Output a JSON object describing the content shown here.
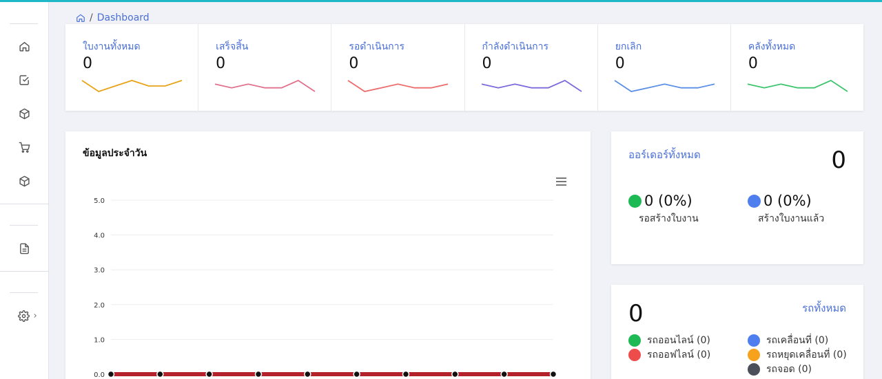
{
  "breadcrumb": {
    "home_icon": "home-icon",
    "separator": "/",
    "current": "Dashboard"
  },
  "sidebar": {
    "icons": [
      "home-icon",
      "checkbox-icon",
      "box-icon",
      "cart-icon",
      "box-icon",
      "document-icon",
      "gear-icon",
      "chevron-right-icon"
    ]
  },
  "stats": [
    {
      "label": "ใบงานทั้งหมด",
      "value": "0",
      "color": "#e8a317",
      "spark": [
        2,
        0,
        1,
        2,
        1,
        1,
        2
      ]
    },
    {
      "label": "เสร็จสิ้น",
      "value": "0",
      "color": "#e0718d",
      "spark": [
        2,
        1,
        2,
        1,
        1,
        3,
        0
      ]
    },
    {
      "label": "รอดำเนินการ",
      "value": "0",
      "color": "#ec6b6b",
      "spark": [
        3,
        0,
        1,
        2,
        1,
        1,
        2
      ]
    },
    {
      "label": "กำลังดำเนินการ",
      "value": "0",
      "color": "#7b68d9",
      "spark": [
        2,
        1,
        2,
        1,
        1,
        3,
        0
      ]
    },
    {
      "label": "ยกเลิก",
      "value": "0",
      "color": "#5b8ee6",
      "spark": [
        3,
        0,
        1,
        2,
        1,
        1,
        2
      ]
    },
    {
      "label": "คลังทั้งหมด",
      "value": "0",
      "color": "#3cc46d",
      "spark": [
        2,
        1,
        2,
        1,
        1,
        3,
        0
      ]
    }
  ],
  "daily": {
    "title": "ข้อมูลประจำวัน",
    "menu_icon": "hamburger-menu-icon"
  },
  "chart_data": {
    "type": "line",
    "title": "ข้อมูลประจำวัน",
    "xlabel": "",
    "ylabel": "",
    "ylim": [
      0,
      5
    ],
    "y_ticks": [
      "0.0",
      "1.0",
      "2.0",
      "3.0",
      "4.0",
      "5.0"
    ],
    "grid": true,
    "series": [
      {
        "values": [
          0,
          0,
          0,
          0,
          0,
          0,
          0,
          0,
          0,
          0
        ],
        "color": "#b3222a"
      }
    ]
  },
  "orders": {
    "title": "ออร์เดอร์ทั้งหมด",
    "total": "0",
    "items": [
      {
        "value": "0 (0%)",
        "label": "รอสร้างใบงาน",
        "color": "#1db954"
      },
      {
        "value": "0 (0%)",
        "label": "สร้างใบงานแล้ว",
        "color": "#4f7fef"
      }
    ]
  },
  "vehicles": {
    "title": "รถทั้งหมด",
    "total": "0",
    "items": [
      {
        "label": "รถออนไลน์ (0)",
        "color": "#1db954"
      },
      {
        "label": "รถออฟไลน์ (0)",
        "color": "#ee4b4b"
      },
      {
        "label": "รถเคลื่อนที่ (0)",
        "color": "#4f7fef"
      },
      {
        "label": "รถหยุดเคลื่อนที่ (0)",
        "color": "#f6a21d"
      },
      {
        "label": "รถจอด (0)",
        "color": "#4b4f5a"
      }
    ]
  }
}
